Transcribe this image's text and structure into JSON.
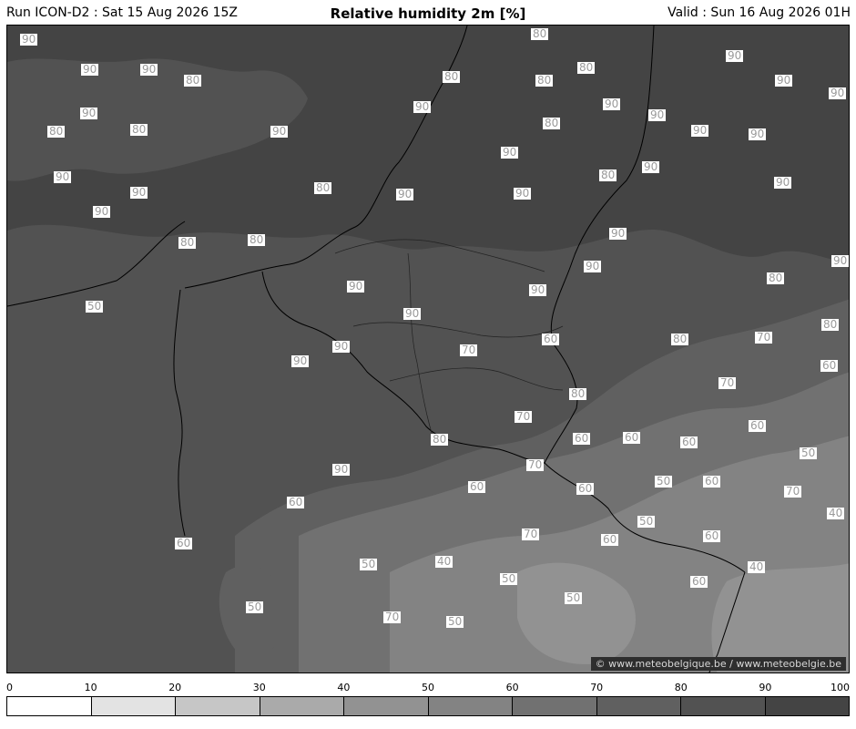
{
  "header": {
    "run": "Run ICON-D2 : Sat 15 Aug 2026 15Z",
    "title": "Relative humidity 2m [%]",
    "valid": "Valid : Sun 16 Aug 2026 01H"
  },
  "copyright": "© www.meteobelgique.be / www.meteobelgie.be",
  "colorbar": {
    "ticks": [
      "0",
      "10",
      "20",
      "30",
      "40",
      "50",
      "60",
      "70",
      "80",
      "90",
      "100"
    ],
    "colors": [
      "#ffffff",
      "#e3e3e3",
      "#c6c6c6",
      "#aaaaaa",
      "#929292",
      "#838383",
      "#717171",
      "#606060",
      "#525252",
      "#444444"
    ]
  },
  "map": {
    "fill_colors": {
      "rh_90": "#444444",
      "rh_80": "#525252",
      "rh_70": "#606060",
      "rh_60": "#717171",
      "rh_50": "#838383",
      "rh_40": "#929292"
    },
    "contour_labels": [
      {
        "text": "90"
      },
      {
        "text": "90"
      },
      {
        "text": "90"
      },
      {
        "text": "80"
      },
      {
        "text": "90"
      },
      {
        "text": "80"
      },
      {
        "text": "80"
      },
      {
        "text": "90"
      },
      {
        "text": "80"
      },
      {
        "text": "90"
      },
      {
        "text": "80"
      },
      {
        "text": "80"
      },
      {
        "text": "80"
      },
      {
        "text": "90"
      },
      {
        "text": "90"
      },
      {
        "text": "90"
      },
      {
        "text": "90"
      },
      {
        "text": "90"
      },
      {
        "text": "90"
      },
      {
        "text": "80"
      },
      {
        "text": "90"
      },
      {
        "text": "90"
      },
      {
        "text": "90"
      },
      {
        "text": "90"
      },
      {
        "text": "80"
      },
      {
        "text": "90"
      },
      {
        "text": "80"
      },
      {
        "text": "90"
      },
      {
        "text": "90"
      },
      {
        "text": "90"
      },
      {
        "text": "90"
      },
      {
        "text": "90"
      },
      {
        "text": "90"
      },
      {
        "text": "90"
      },
      {
        "text": "90"
      },
      {
        "text": "90"
      },
      {
        "text": "90"
      },
      {
        "text": "90"
      },
      {
        "text": "80"
      },
      {
        "text": "80"
      },
      {
        "text": "80"
      },
      {
        "text": "90"
      },
      {
        "text": "60"
      },
      {
        "text": "70"
      },
      {
        "text": "80"
      },
      {
        "text": "70"
      },
      {
        "text": "70"
      },
      {
        "text": "60"
      },
      {
        "text": "60"
      },
      {
        "text": "80"
      },
      {
        "text": "70"
      },
      {
        "text": "60"
      },
      {
        "text": "50"
      },
      {
        "text": "80"
      },
      {
        "text": "60"
      },
      {
        "text": "60"
      },
      {
        "text": "50"
      },
      {
        "text": "80"
      },
      {
        "text": "90"
      },
      {
        "text": "50"
      },
      {
        "text": "60"
      },
      {
        "text": "70"
      },
      {
        "text": "60"
      },
      {
        "text": "50"
      },
      {
        "text": "70"
      },
      {
        "text": "60"
      },
      {
        "text": "60"
      },
      {
        "text": "40"
      },
      {
        "text": "70"
      },
      {
        "text": "60"
      },
      {
        "text": "60"
      },
      {
        "text": "60"
      },
      {
        "text": "40"
      },
      {
        "text": "40"
      },
      {
        "text": "50"
      },
      {
        "text": "50"
      },
      {
        "text": "60"
      },
      {
        "text": "50"
      },
      {
        "text": "50"
      },
      {
        "text": "70"
      },
      {
        "text": "50"
      }
    ]
  }
}
